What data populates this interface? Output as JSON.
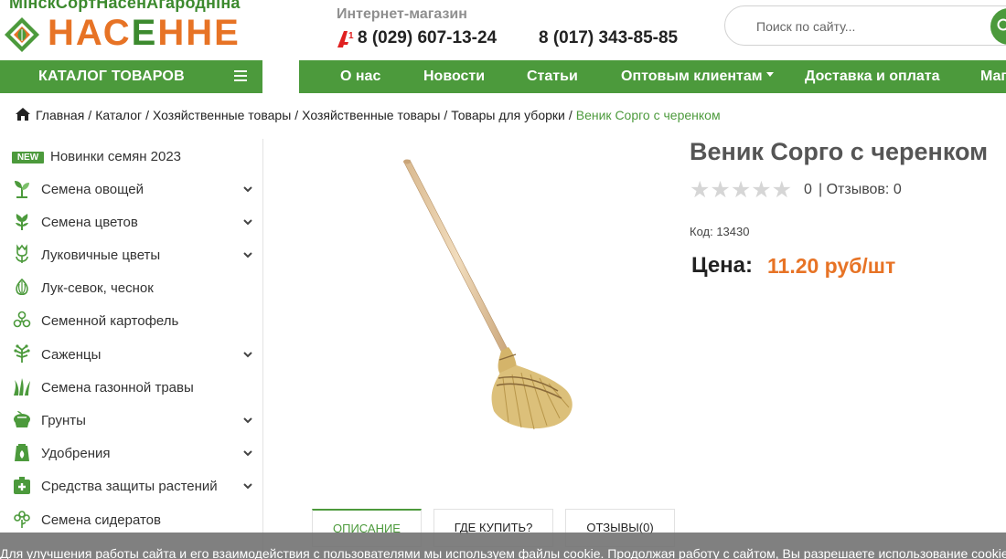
{
  "header": {
    "logo_top": "МінскСортНасенАгароднiна",
    "logo_word_before": "НАС",
    "logo_word_leaf": "Е",
    "logo_word_after": "ННЕ",
    "shop_label": "Интернет-магазин",
    "phone_1": "8 (029) 607-13-24",
    "phone_2": "8 (017) 343-85-85",
    "search_placeholder": "Поиск по сайту..."
  },
  "nav": {
    "catalog_label": "КАТАЛОГ ТОВАРОВ",
    "items": [
      "О нас",
      "Новости",
      "Статьи",
      "Оптовым клиентам",
      "Доставка и оплата",
      "Магазины"
    ]
  },
  "breadcrumb": {
    "items": [
      "Главная",
      "Каталог",
      "Хозяйственные товары",
      "Хозяйственные товары",
      "Товары для уборки"
    ],
    "current": "Веник Сорго с черенком"
  },
  "sidebar": {
    "new_badge": "NEW",
    "items": [
      {
        "label": "Новинки семян 2023",
        "icon": "new-badge",
        "has_children": false
      },
      {
        "label": "Семена овощей",
        "icon": "vegetable-sprout-icon",
        "has_children": true
      },
      {
        "label": "Семена цветов",
        "icon": "flower-icon",
        "has_children": true
      },
      {
        "label": "Луковичные цветы",
        "icon": "tulip-icon",
        "has_children": true
      },
      {
        "label": "Лук-севок, чеснок",
        "icon": "onion-icon",
        "has_children": false
      },
      {
        "label": "Семенной картофель",
        "icon": "potato-icon",
        "has_children": false
      },
      {
        "label": "Саженцы",
        "icon": "seedling-icon",
        "has_children": true
      },
      {
        "label": "Семена газонной травы",
        "icon": "grass-icon",
        "has_children": false
      },
      {
        "label": "Грунты",
        "icon": "soil-pot-icon",
        "has_children": true
      },
      {
        "label": "Удобрения",
        "icon": "fertilizer-icon",
        "has_children": true
      },
      {
        "label": "Средства защиты растений",
        "icon": "plant-protection-icon",
        "has_children": true
      },
      {
        "label": "Семена сидератов",
        "icon": "green-manure-icon",
        "has_children": false
      }
    ]
  },
  "product": {
    "title": "Веник Сорго с черенком",
    "stars": "★★★★★",
    "rating_value": "0",
    "reviews": "| Отзывов: 0",
    "code": "Код: 13430",
    "price_label": "Цена:",
    "price_value": "11.20 руб/шт",
    "image_icon": "broom-icon"
  },
  "tabs": [
    "Описание",
    "Где купить?",
    "Отзывы(0)"
  ],
  "cookie_text": "Для улучшения работы сайта и его взаимодействия с пользователями мы используем файлы cookie. Продолжая работу с сайтом, Вы разрешаете использование cookie-файлов.",
  "colors": {
    "brand_green": "#4c9a3c",
    "brand_orange": "#e77325",
    "star_empty": "#d6d6d6"
  }
}
